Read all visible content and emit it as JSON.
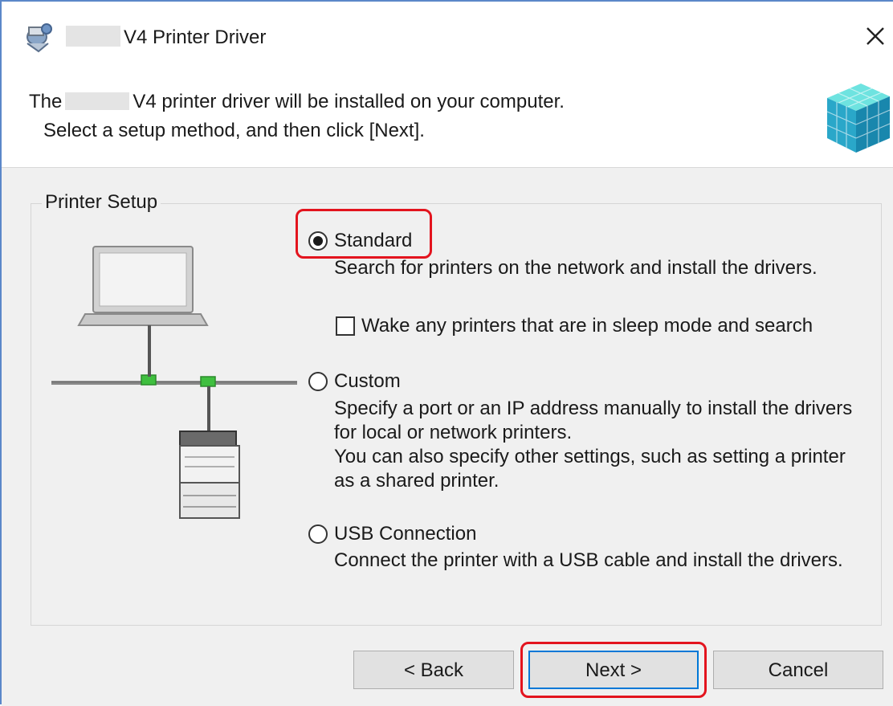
{
  "window": {
    "title": "V4 Printer Driver",
    "close_symbol": "✕"
  },
  "header": {
    "line1_prefix": "The",
    "line1_suffix": "V4 printer driver will be installed on your computer.",
    "line2": "Select a setup method, and then click [Next]."
  },
  "group": {
    "label": "Printer Setup"
  },
  "options": {
    "standard": {
      "label": "Standard",
      "selected": true,
      "description": "Search for printers on the network and install the drivers.",
      "wake_checkbox": {
        "label": "Wake any printers that are in sleep mode and search",
        "checked": false
      }
    },
    "custom": {
      "label": "Custom",
      "selected": false,
      "description": "Specify a port or an IP address manually to install the drivers\nfor local or network printers.\nYou can also specify other settings, such as setting a printer\nas a shared printer."
    },
    "usb": {
      "label": "USB Connection",
      "selected": false,
      "description": "Connect the printer with a USB cable and install the drivers."
    }
  },
  "buttons": {
    "back": "< Back",
    "next": "Next >",
    "cancel": "Cancel"
  },
  "colors": {
    "highlight": "#e3141e",
    "default_button_border": "#0078d7",
    "window_border": "#5b87c9"
  },
  "icons": {
    "app": "printer-driver-icon",
    "header": "cube-stack-icon",
    "close": "close-icon"
  }
}
